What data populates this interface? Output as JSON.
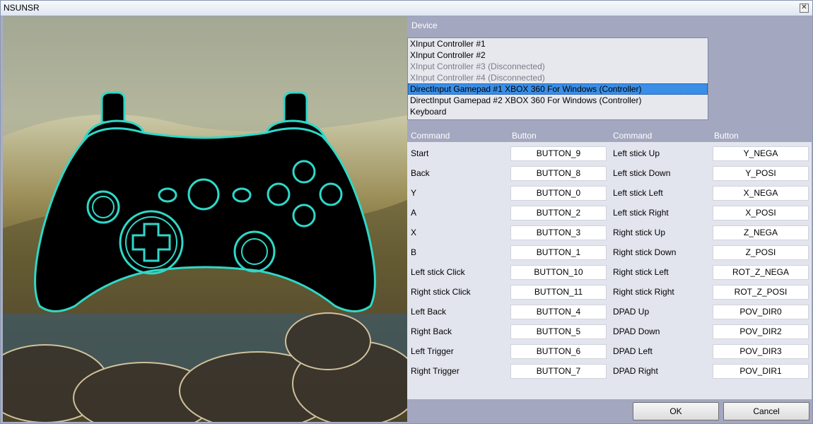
{
  "window": {
    "title": "NSUNSR",
    "close_glyph": "✕"
  },
  "device": {
    "label": "Device",
    "items": [
      {
        "label": "XInput Controller #1",
        "state": "normal"
      },
      {
        "label": "XInput Controller #2",
        "state": "normal"
      },
      {
        "label": "XInput Controller #3 (Disconnected)",
        "state": "disabled"
      },
      {
        "label": "XInput Controller #4 (Disconnected)",
        "state": "disabled"
      },
      {
        "label": "DirectInput Gamepad #1 XBOX 360 For Windows (Controller)",
        "state": "selected"
      },
      {
        "label": "DirectInput Gamepad #2 XBOX 360 For Windows (Controller)",
        "state": "normal"
      },
      {
        "label": "Keyboard",
        "state": "normal"
      }
    ]
  },
  "mapping": {
    "headers": {
      "command1": "Command",
      "button1": "Button",
      "command2": "Command",
      "button2": "Button"
    },
    "rows": [
      {
        "cmd1": "Start",
        "btn1": "BUTTON_9",
        "cmd2": "Left stick Up",
        "btn2": "Y_NEGA"
      },
      {
        "cmd1": "Back",
        "btn1": "BUTTON_8",
        "cmd2": "Left stick Down",
        "btn2": "Y_POSI"
      },
      {
        "cmd1": "Y",
        "btn1": "BUTTON_0",
        "cmd2": "Left stick Left",
        "btn2": "X_NEGA"
      },
      {
        "cmd1": "A",
        "btn1": "BUTTON_2",
        "cmd2": "Left stick Right",
        "btn2": "X_POSI"
      },
      {
        "cmd1": "X",
        "btn1": "BUTTON_3",
        "cmd2": "Right stick Up",
        "btn2": "Z_NEGA"
      },
      {
        "cmd1": "B",
        "btn1": "BUTTON_1",
        "cmd2": "Right stick Down",
        "btn2": "Z_POSI"
      },
      {
        "cmd1": "Left stick Click",
        "btn1": "BUTTON_10",
        "cmd2": "Right stick Left",
        "btn2": "ROT_Z_NEGA"
      },
      {
        "cmd1": "Right stick Click",
        "btn1": "BUTTON_11",
        "cmd2": "Right stick Right",
        "btn2": "ROT_Z_POSI"
      },
      {
        "cmd1": "Left Back",
        "btn1": "BUTTON_4",
        "cmd2": "DPAD Up",
        "btn2": "POV_DIR0"
      },
      {
        "cmd1": "Right Back",
        "btn1": "BUTTON_5",
        "cmd2": "DPAD Down",
        "btn2": "POV_DIR2"
      },
      {
        "cmd1": "Left Trigger",
        "btn1": "BUTTON_6",
        "cmd2": "DPAD Left",
        "btn2": "POV_DIR3"
      },
      {
        "cmd1": "Right Trigger",
        "btn1": "BUTTON_7",
        "cmd2": "DPAD Right",
        "btn2": "POV_DIR1"
      }
    ]
  },
  "buttons": {
    "ok": "OK",
    "cancel": "Cancel"
  },
  "colors": {
    "accent_outline": "#2fd8c8",
    "selection": "#3b8ee6",
    "panel": "#a4a7c0"
  },
  "icons": {
    "controller": "gamepad-illustration"
  }
}
